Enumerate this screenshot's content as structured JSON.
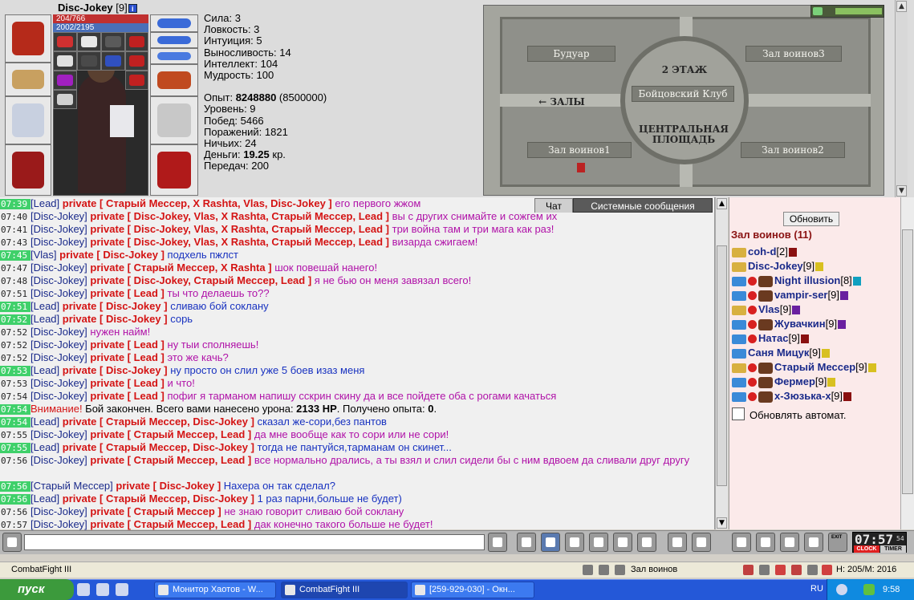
{
  "character": {
    "name": "Disc-Jokey",
    "level": "[9]",
    "hp": "204/766",
    "mana": "2002/2195",
    "info_icon": "i"
  },
  "stats": [
    "Сила: 3",
    "Ловкость: 3",
    "Интуиция: 5",
    "Выносливость: 14",
    "Интеллект: 104",
    "Мудрость: 100"
  ],
  "stats2": {
    "exp_label": "Опыт: ",
    "exp_value": "8248880",
    "exp_next": " (8500000)",
    "level": "Уровень: 9",
    "wins": "Побед: 5466",
    "losses": "Поражений: 1821",
    "draws": "Ничьих: 24",
    "money_label": "Деньги: ",
    "money_value": "19.25",
    "money_unit": " кр.",
    "transfers": "Передач: 200"
  },
  "map": {
    "boudoir": "Будуар",
    "hall3": "Зал воинов3",
    "floor": "2 ЭТАЖ",
    "club": "Бойцовский Клуб",
    "halls": "← ЗАЛЫ",
    "central_1": "ЦЕНТРАЛЬНАЯ",
    "central_2": "ПЛОЩАДЬ",
    "hall1": "Зал воинов1",
    "hall2": "Зал воинов2"
  },
  "tabs": {
    "chat": "Чат",
    "system": "Системные сообщения"
  },
  "chat": [
    {
      "time": "07:39",
      "hl": true,
      "nick": "[Lead]",
      "priv": "private [ Старый Мессер, X Rashta, Vlas, Disc-Jokey ]",
      "text": "его первого жжом",
      "cls": "txt"
    },
    {
      "time": "07:40",
      "hl": false,
      "nick": "[Disc-Jokey]",
      "priv": "private [ Disc-Jokey, Vlas, X Rashta, Старый Мессер, Lead ]",
      "text": "вы с других снимайте и сожгем их",
      "cls": "txt"
    },
    {
      "time": "07:41",
      "hl": false,
      "nick": "[Disc-Jokey]",
      "priv": "private [ Disc-Jokey, Vlas, X Rashta, Старый Мессер, Lead ]",
      "text": "три война там и три мага как раз!",
      "cls": "txt"
    },
    {
      "time": "07:43",
      "hl": false,
      "nick": "[Disc-Jokey]",
      "priv": "private [ Disc-Jokey, Vlas, X Rashta, Старый Мессер, Lead ]",
      "text": "визарда сжигаем!",
      "cls": "txt"
    },
    {
      "time": "07:45",
      "hl": true,
      "nick": "[Vlas]",
      "priv": "private [ Disc-Jokey ]",
      "text": "подхель пжлст",
      "cls": "txt blue"
    },
    {
      "time": "07:47",
      "hl": false,
      "nick": "[Disc-Jokey]",
      "priv": "private [ Старый Мессер, X Rashta ]",
      "text": "шок повешай нанего!",
      "cls": "txt"
    },
    {
      "time": "07:48",
      "hl": false,
      "nick": "[Disc-Jokey]",
      "priv": "private [ Disc-Jokey, Старый Мессер, Lead ]",
      "text": "я не бью он меня завязал всего!",
      "cls": "txt"
    },
    {
      "time": "07:51",
      "hl": false,
      "nick": "[Disc-Jokey]",
      "priv": "private [ Lead ]",
      "text": "ты что делаешь то??",
      "cls": "txt"
    },
    {
      "time": "07:51",
      "hl": true,
      "nick": "[Lead]",
      "priv": "private [ Disc-Jokey ]",
      "text": "сливаю бой соклану",
      "cls": "txt blue"
    },
    {
      "time": "07:52",
      "hl": true,
      "nick": "[Lead]",
      "priv": "private [ Disc-Jokey ]",
      "text": "сорь",
      "cls": "txt blue"
    },
    {
      "time": "07:52",
      "hl": false,
      "nick": "[Disc-Jokey]",
      "priv": "",
      "text": "нужен найм!",
      "cls": "txt"
    },
    {
      "time": "07:52",
      "hl": false,
      "nick": "[Disc-Jokey]",
      "priv": "private [ Lead ]",
      "text": "ну тыи сполняешь!",
      "cls": "txt"
    },
    {
      "time": "07:52",
      "hl": false,
      "nick": "[Disc-Jokey]",
      "priv": "private [ Lead ]",
      "text": "это же качь?",
      "cls": "txt"
    },
    {
      "time": "07:53",
      "hl": true,
      "nick": "[Lead]",
      "priv": "private [ Disc-Jokey ]",
      "text": "ну просто он слил уже 5 боев изаз меня",
      "cls": "txt blue"
    },
    {
      "time": "07:53",
      "hl": false,
      "nick": "[Disc-Jokey]",
      "priv": "private [ Lead ]",
      "text": "и что!",
      "cls": "txt"
    },
    {
      "time": "07:54",
      "hl": false,
      "nick": "[Disc-Jokey]",
      "priv": "private [ Lead ]",
      "text": "пофиг я тарманом напишу сскрин скину да и все пойдете оба с рогами качаться",
      "cls": "txt"
    }
  ],
  "system_msg": {
    "time": "07:54",
    "warn": "Внимание!",
    "text1": " Бой закончен. Всего вами нанесено урона: ",
    "damage": "2133 HP",
    "text2": ". Получено опыта: ",
    "exp": "0",
    "text3": "."
  },
  "chat2": [
    {
      "time": "07:54",
      "hl": true,
      "nick": "[Lead]",
      "priv": "private [ Старый Мессер, Disc-Jokey ]",
      "text": "сказал же-сори,без пантов",
      "cls": "txt blue"
    },
    {
      "time": "07:55",
      "hl": false,
      "nick": "[Disc-Jokey]",
      "priv": "private [ Старый Мессер, Lead ]",
      "text": "да мне вообще как то сори или не сори!",
      "cls": "txt"
    },
    {
      "time": "07:55",
      "hl": true,
      "nick": "[Lead]",
      "priv": "private [ Старый Мессер, Disc-Jokey ]",
      "text": "тогда не пантуйся,тарманам он скинет...",
      "cls": "txt blue"
    },
    {
      "time": "07:56",
      "hl": false,
      "nick": "[Disc-Jokey]",
      "priv": "private [ Старый Мессер, Lead ]",
      "text": "все нормально дрались, а ты взял и слил сидели бы с ним вдвоем да сливали друг другу",
      "cls": "txt",
      "wrap": true
    },
    {
      "time": "07:56",
      "hl": true,
      "nick": "[Старый Мессер]",
      "priv": "private [ Disc-Jokey ]",
      "text": "Нахера он так сделал?",
      "cls": "txt blue"
    },
    {
      "time": "07:56",
      "hl": true,
      "nick": "[Lead]",
      "priv": "private [ Старый Мессер, Disc-Jokey ]",
      "text": "1 раз парни,больше не будет)",
      "cls": "txt blue"
    },
    {
      "time": "07:56",
      "hl": false,
      "nick": "[Disc-Jokey]",
      "priv": "private [ Старый Мессер ]",
      "text": "не знаю говорит сливаю бой соклану",
      "cls": "txt"
    },
    {
      "time": "07:57",
      "hl": false,
      "nick": "[Disc-Jokey]",
      "priv": "private [ Старый Мессер, Lead ]",
      "text": "дак конечно такого больше не будет!",
      "cls": "txt"
    }
  ],
  "room": {
    "refresh": "Обновить",
    "title": "Зал воинов (11)",
    "auto_refresh": "Обновлять автомат."
  },
  "users": [
    {
      "name": "coh-d",
      "lvl": "[2]",
      "badge": "b-red",
      "icons": "a"
    },
    {
      "name": "Disc-Jokey",
      "lvl": "[9]",
      "badge": "b-yel",
      "icons": "a"
    },
    {
      "name": "Night illusion",
      "lvl": "[8]",
      "badge": "b-cyan",
      "icons": "bca"
    },
    {
      "name": "vampir-ser",
      "lvl": "[9]",
      "badge": "b-pur",
      "icons": "bca"
    },
    {
      "name": "Vlas",
      "lvl": "[9]",
      "badge": "b-pur",
      "icons": "ac"
    },
    {
      "name": "Жувачкин",
      "lvl": "[9]",
      "badge": "b-pur",
      "icons": "bca"
    },
    {
      "name": "Натас",
      "lvl": "[9]",
      "badge": "b-red",
      "icons": "bc"
    },
    {
      "name": "Саня Мицук",
      "lvl": "[9]",
      "badge": "b-yel",
      "icons": "b"
    },
    {
      "name": "Старый Мессер",
      "lvl": "[9]",
      "badge": "b-yel",
      "icons": "aca"
    },
    {
      "name": "Фермер",
      "lvl": "[9]",
      "badge": "b-yel",
      "icons": "bca"
    },
    {
      "name": "x-Зюзька-x",
      "lvl": "[9]",
      "badge": "b-red",
      "icons": "bca"
    }
  ],
  "clock": {
    "time": "07:57",
    "sec": "54",
    "clock_label": "CLOCK",
    "timer_label": "TIMER",
    "exit": "EXIT"
  },
  "statusbar": {
    "app": "CombatFight III",
    "room": "Зал воинов",
    "hp": "Н: 205/М: 2016"
  },
  "taskbar": {
    "start": "пуск",
    "tasks": [
      "Монитор Хаотов - W...",
      "CombatFight III",
      "[259-929-030] - Окн..."
    ],
    "lang": "RU",
    "time": "9:58"
  },
  "colors": {
    "nick": "#1a2a8a",
    "private": "#d41414",
    "text_pink": "#b012a8",
    "text_blue": "#1832c0",
    "time_highlight": "#3fd06a",
    "room_bg": "#fbeaea"
  }
}
